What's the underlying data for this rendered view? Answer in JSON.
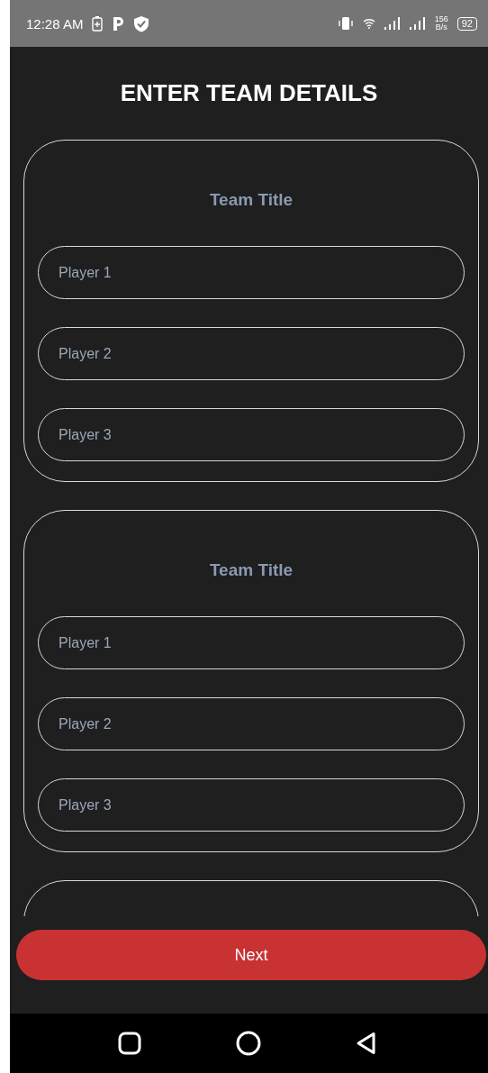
{
  "status_bar": {
    "time": "12:28 AM",
    "net_speed": "156",
    "net_unit": "B/s",
    "battery": "92"
  },
  "title": "ENTER TEAM DETAILS",
  "teams": [
    {
      "kind": "form",
      "title": "Team Title",
      "players": [
        {
          "placeholder": "Player 1"
        },
        {
          "placeholder": "Player 2"
        },
        {
          "placeholder": "Player 3"
        }
      ]
    },
    {
      "kind": "form",
      "title": "Team Title",
      "players": [
        {
          "placeholder": "Player 1"
        },
        {
          "placeholder": "Player 2"
        },
        {
          "placeholder": "Player 3"
        }
      ]
    },
    {
      "kind": "form"
    }
  ],
  "next_button": "Next"
}
